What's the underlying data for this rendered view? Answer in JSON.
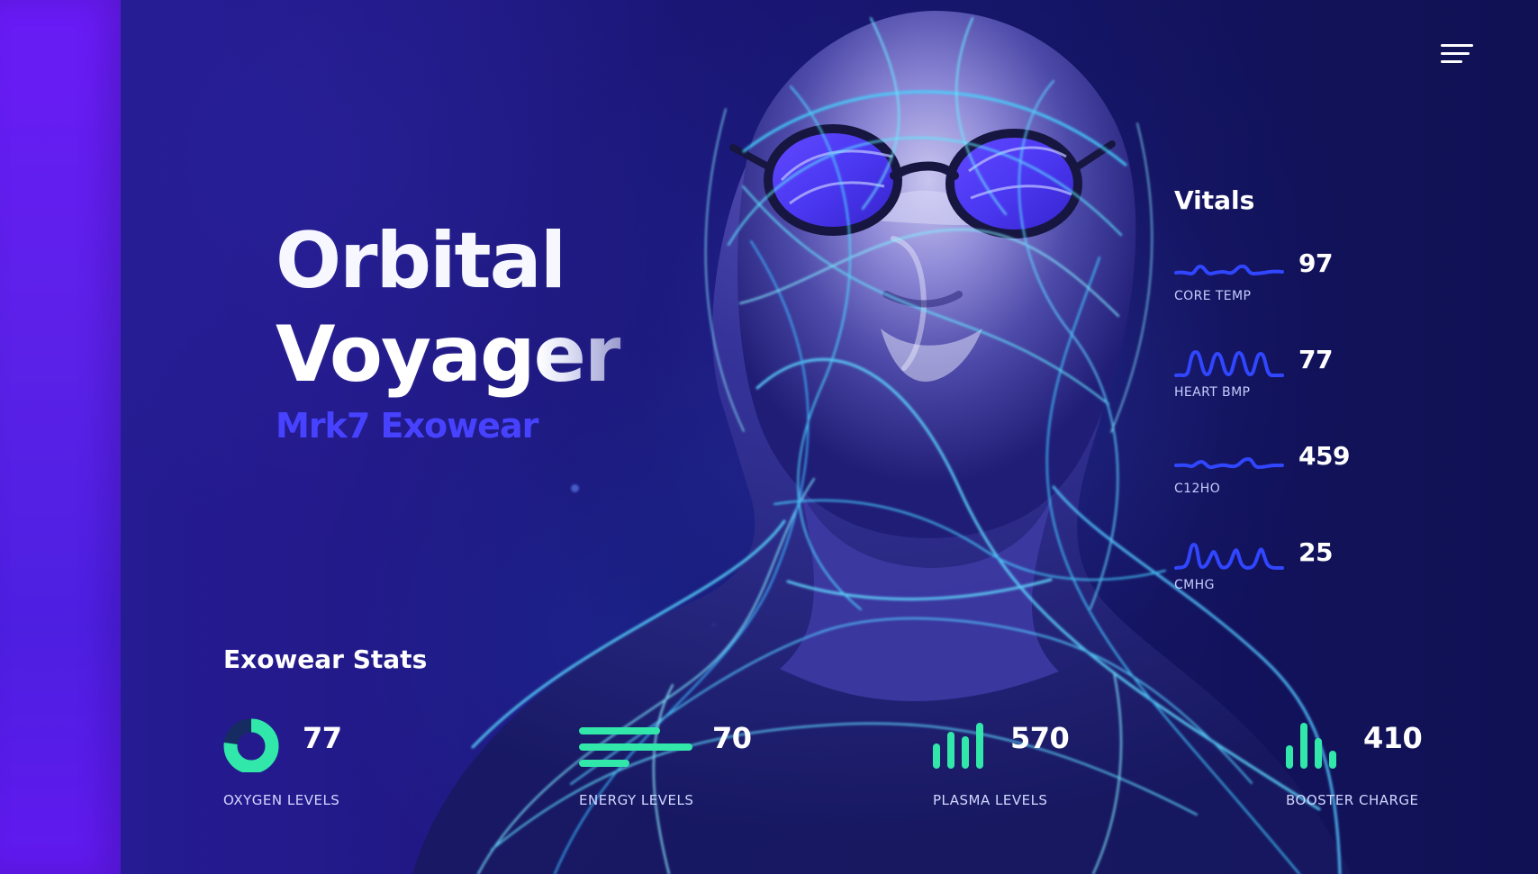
{
  "colors": {
    "accent_blue": "#4742ff",
    "accent_green": "#31e7aa",
    "wave_blue": "#3046ff",
    "background_deep": "#1a1563",
    "edge_purple": "#5b21e8"
  },
  "header": {
    "menu_icon": "hamburger-menu-icon"
  },
  "hero": {
    "title_line_1": "Orbital",
    "title_line_2": "Voyager",
    "subtitle": "Mrk7 Exowear"
  },
  "vitals": {
    "title": "Vitals",
    "items": [
      {
        "value": "97",
        "label": "CORE TEMP",
        "icon": "wave-line-icon"
      },
      {
        "value": "77",
        "label": "HEART BMP",
        "icon": "heartbeat-wave-icon"
      },
      {
        "value": "459",
        "label": "C12HO",
        "icon": "wave-line-icon"
      },
      {
        "value": "25",
        "label": "CMHG",
        "icon": "pulse-wave-icon"
      }
    ]
  },
  "stats": {
    "title": "Exowear Stats",
    "items": [
      {
        "value": "77",
        "label": "OXYGEN LEVELS",
        "icon": "circular-progress-icon",
        "progress": 0.77
      },
      {
        "value": "70",
        "label": "ENERGY LEVELS",
        "icon": "horizontal-bars-icon"
      },
      {
        "value": "570",
        "label": "PLASMA LEVELS",
        "icon": "vertical-bars-icon"
      },
      {
        "value": "410",
        "label": "BOOSTER CHARGE",
        "icon": "vertical-bars-icon"
      }
    ]
  }
}
